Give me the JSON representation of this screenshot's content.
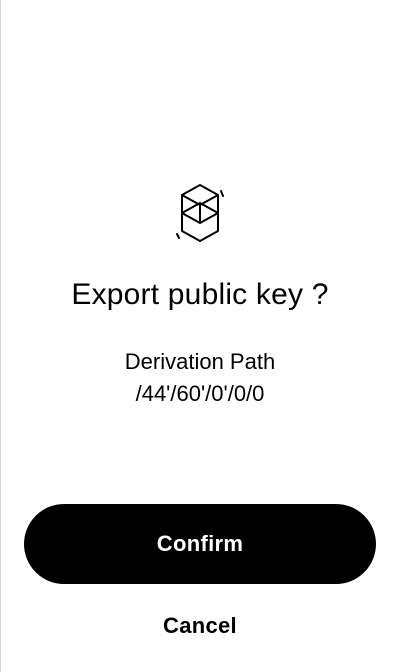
{
  "app": {
    "icon": "fantom-cube-icon"
  },
  "dialog": {
    "title": "Export public key ?",
    "derivation_label": "Derivation Path",
    "derivation_path": "/44'/60'/0'/0/0"
  },
  "actions": {
    "confirm_label": "Confirm",
    "cancel_label": "Cancel"
  },
  "colors": {
    "background": "#ffffff",
    "primary": "#000000",
    "on_primary": "#ffffff",
    "edge": "#d9d9d9"
  }
}
